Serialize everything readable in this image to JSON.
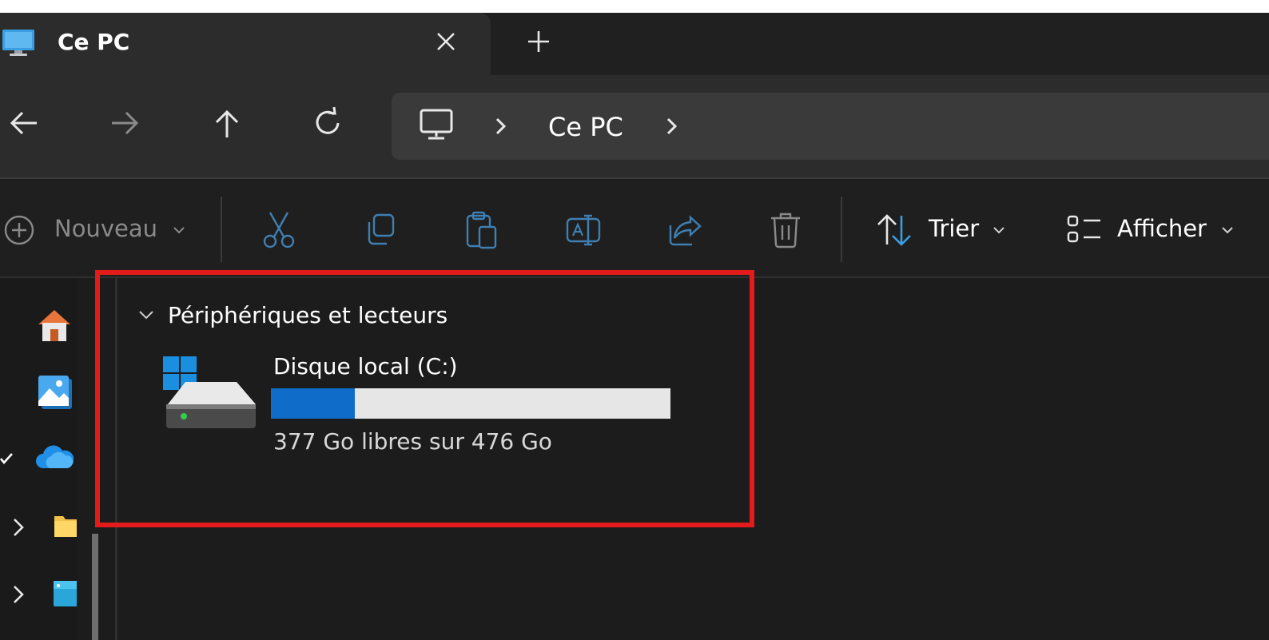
{
  "tab": {
    "title": "Ce PC"
  },
  "address": {
    "segment": "Ce PC"
  },
  "toolbar": {
    "new_label": "Nouveau",
    "sort_label": "Trier",
    "view_label": "Afficher"
  },
  "group": {
    "label": "Périphériques et lecteurs"
  },
  "drive": {
    "name": "Disque local (C:)",
    "space_text": "377 Go libres sur 476 Go",
    "used_fraction": 0.21,
    "free_gb": 377,
    "total_gb": 476
  },
  "colors": {
    "accent": "#0f6cc9",
    "highlight": "#e31b1b"
  }
}
